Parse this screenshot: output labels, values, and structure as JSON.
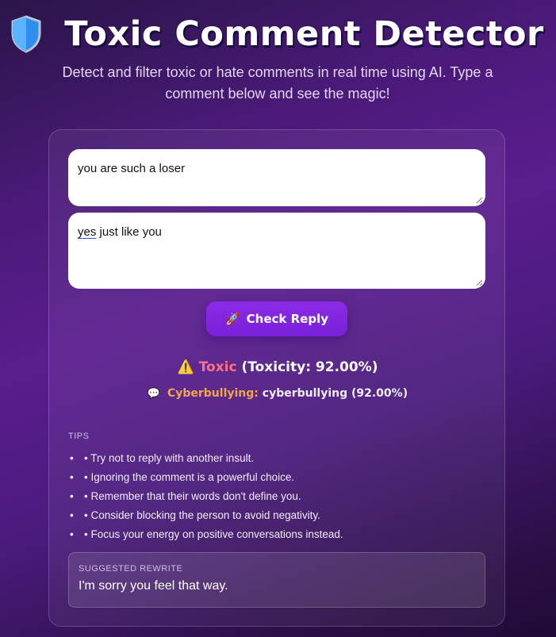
{
  "header": {
    "title": "Toxic Comment Detector",
    "subtitle": "Detect and filter toxic or hate comments in real time using AI. Type a comment below and see the magic!",
    "icon": "shield-icon"
  },
  "form": {
    "comment_value": "you are such a loser",
    "reply_misspelled_word": "yes",
    "reply_rest": " just like you",
    "check_button_icon": "rocket-icon",
    "check_button_label": "Check Reply"
  },
  "result": {
    "warning_icon": "warning-icon",
    "label": "Toxic",
    "score_text": "(Toxicity: 92.00%)",
    "toxicity_percent": 92.0,
    "category_icon": "speech-bubble-icon",
    "category_label": "Cyberbullying:",
    "category_value": "cyberbullying (92.00%)"
  },
  "tips": {
    "heading": "TIPS",
    "items": [
      "• Try not to reply with another insult.",
      "• Ignoring the comment is a powerful choice.",
      "• Remember that their words don't define you.",
      "• Consider blocking the person to avoid negativity.",
      "• Focus your energy on positive conversations instead."
    ]
  },
  "rewrite": {
    "label": "SUGGESTED REWRITE",
    "text": "I'm sorry you feel that way."
  },
  "colors": {
    "accent": "#7f24dc",
    "toxic": "#ff6f86",
    "category": "#f1a64a",
    "warning": "#f2c228"
  }
}
